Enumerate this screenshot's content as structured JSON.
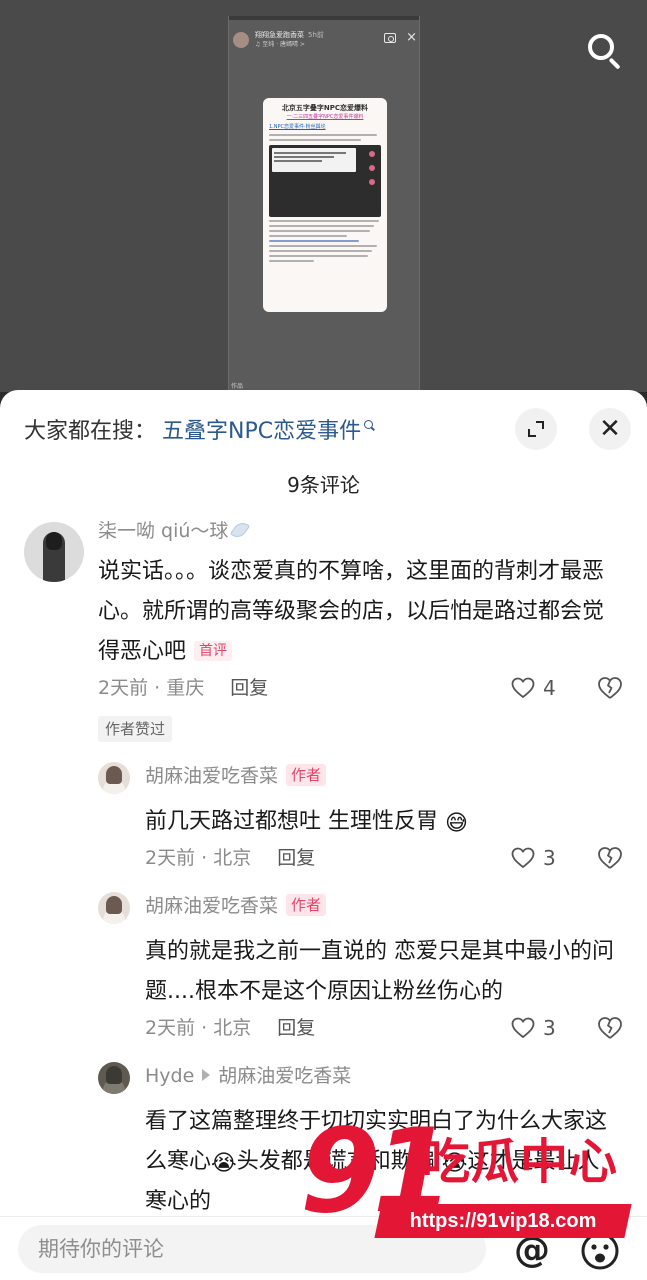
{
  "video": {
    "frame_header": {
      "account": "翔翔急爱跑香菜",
      "time": "5h前",
      "music": "♫ 至纯 · 唐嫣晴 >"
    },
    "post": {
      "title": "北京五字叠字NPC恋爱爆料",
      "subtitle": "一·二三四五叠字NPC恋爱事件爆料",
      "section": "1.NPC恋爱事件·粉丝舆论"
    },
    "frame_footer": "作品",
    "search_icon": "search-icon"
  },
  "sheet": {
    "search_label": "大家都在搜：",
    "search_term": "五叠字NPC恋爱事件",
    "comment_count": "9条评论",
    "expand_icon": "expand-icon",
    "close_icon": "close-icon"
  },
  "main_comment": {
    "username": "柒一呦 qiú～球",
    "text": "说实话。。。谈恋爱真的不算啥，这里面的背刺才最恶心。就所谓的高等级聚会的店，以后怕是路过都会觉得恶心吧",
    "badge": "首评",
    "time_location": "2天前 · 重庆",
    "reply_label": "回复",
    "likes": "4",
    "tag": "作者赞过"
  },
  "replies": [
    {
      "username": "胡麻油爱吃香菜",
      "badge": "作者",
      "text": "前几天路过都想吐 生理性反胃",
      "emoji": "😅",
      "time_location": "2天前 · 北京",
      "reply_label": "回复",
      "likes": "3"
    },
    {
      "username": "胡麻油爱吃香菜",
      "badge": "作者",
      "text": "真的就是我之前一直说的 恋爱只是其中最小的问题....根本不是这个原因让粉丝伤心的",
      "time_location": "2天前 · 北京",
      "reply_label": "回复",
      "likes": "3"
    },
    {
      "username": "Hyde",
      "reply_to": "胡麻油爱吃香菜",
      "text_part1": "看了这篇整理终于切切实实明白了为什么大家这么寒心",
      "emoji1": "😭",
      "text_part2": "头发都是谎言和欺骗",
      "emoji2": "😭",
      "text_part3": "这才是最让人寒心的"
    }
  ],
  "input_bar": {
    "placeholder": "期待你的评论",
    "at_label": "@"
  },
  "watermark": {
    "number": "91",
    "brand": "吃瓜中心",
    "url": "https://91vip18.com"
  }
}
